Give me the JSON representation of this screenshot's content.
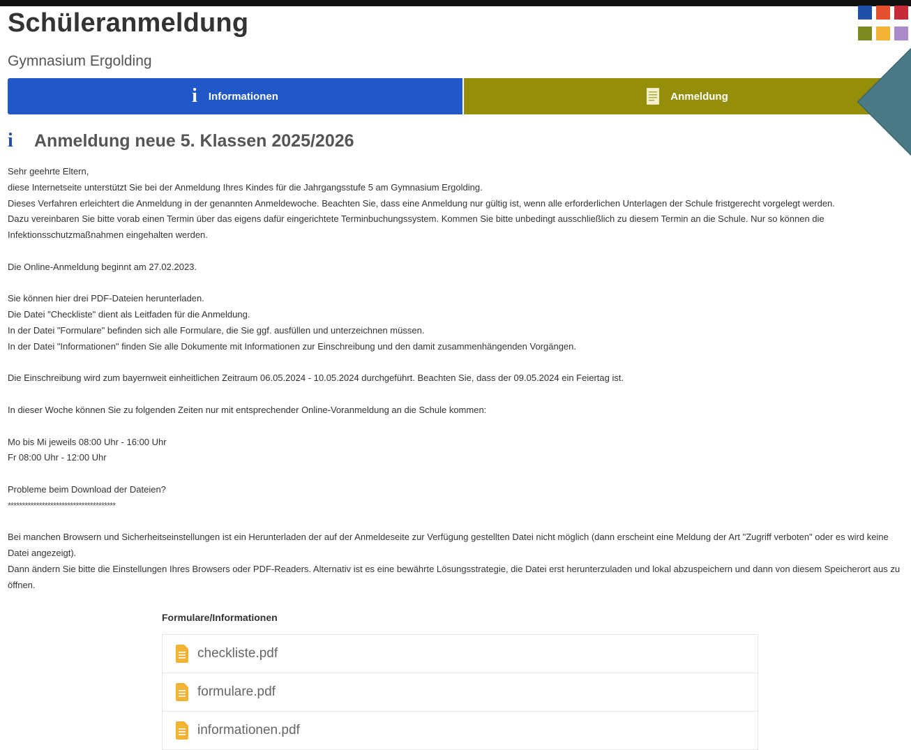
{
  "header": {
    "title": "Schüleranmeldung",
    "school": "Gymnasium Ergolding"
  },
  "logo": {
    "colors": [
      "#1f4fa8",
      "#e4502b",
      "#c42a38",
      "#7d8a1e",
      "#f2b233",
      "#a98cc9"
    ]
  },
  "tabs": [
    {
      "label": "Informationen",
      "icon": "info-icon",
      "color": "#2158c7"
    },
    {
      "label": "Anmeldung",
      "icon": "document-icon",
      "color": "#958e0b"
    }
  ],
  "section": {
    "title": "Anmeldung neue 5. Klassen 2025/2026"
  },
  "content": {
    "greeting": "Sehr geehrte Eltern,",
    "p1": "diese Internetseite unterstützt Sie bei der Anmeldung Ihres Kindes für die Jahrgangsstufe 5 am Gymnasium Ergolding.",
    "p2": "Dieses Verfahren erleichtert die Anmeldung in der genannten Anmeldewoche. Beachten Sie, dass eine Anmeldung nur gültig ist, wenn alle erforderlichen Unterlagen der Schule fristgerecht vorgelegt werden.",
    "p3": "Dazu vereinbaren Sie bitte vorab einen Termin über das eigens dafür eingerichtete Terminbuchungssystem. Kommen Sie bitte unbedingt ausschließlich zu diesem Termin an die Schule. Nur so können die Infektionsschutzmaßnahmen eingehalten werden.",
    "p4": "Die Online-Anmeldung beginnt am 27.02.2023.",
    "p5": "Sie können hier drei PDF-Dateien herunterladen.",
    "p6": "Die Datei \"Checkliste\" dient als Leitfaden für die Anmeldung.",
    "p7": "In der Datei \"Formulare\" befinden sich alle Formulare, die Sie ggf. ausfüllen und unterzeichnen müssen.",
    "p8": "In der Datei \"Informationen\" finden Sie alle Dokumente mit Informationen zur Einschreibung und den damit zusammenhängenden Vorgängen.",
    "p9": "Die Einschreibung wird zum bayernweit einheitlichen Zeitraum 06.05.2024 - 10.05.2024 durchgeführt. Beachten Sie, dass der 09.05.2024 ein Feiertag ist.",
    "p10": "In dieser Woche können Sie zu folgenden Zeiten nur mit entsprechender Online-Voranmeldung an die Schule kommen:",
    "p11": "Mo bis Mi jeweils 08:00 Uhr - 16:00 Uhr",
    "p12": "Fr 08:00 Uhr - 12:00 Uhr",
    "p13": "Probleme beim Download der Dateien?",
    "p14": "**************************************",
    "p15": "Bei manchen Browsern und Sicherheitseinstellungen ist ein Herunterladen der auf der Anmeldeseite zur Verfügung gestellten Datei nicht möglich (dann erscheint eine Meldung der Art \"Zugriff verboten\" oder es wird keine Datei angezeigt).",
    "p16": "Dann ändern Sie bitte die Einstellungen Ihres Browsers oder PDF-Readers. Alternativ ist es eine bewährte Lösungsstrategie, die Datei erst herunterzuladen und lokal abzuspeichern und dann von diesem Speicherort aus zu öffnen."
  },
  "downloads": {
    "title": "Formulare/Informationen",
    "files": [
      "checkliste.pdf",
      "formulare.pdf",
      "informationen.pdf"
    ],
    "icon": "pdf-file-icon",
    "icon_color": "#f2b233"
  }
}
